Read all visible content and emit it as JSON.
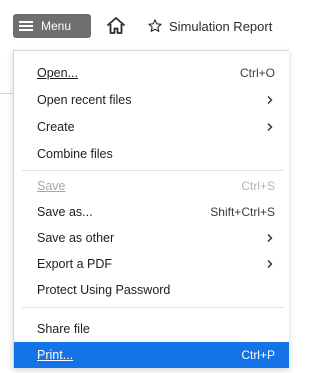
{
  "toolbar": {
    "menu_label": "Menu",
    "tab_title": "Simulation Report"
  },
  "menu": {
    "items": [
      {
        "label": "Open...",
        "shortcut": "Ctrl+O"
      },
      {
        "label": "Open recent files",
        "submenu": true
      },
      {
        "label": "Create",
        "submenu": true
      },
      {
        "label": "Combine files"
      },
      {
        "label": "Save",
        "shortcut": "Ctrl+S",
        "disabled": true
      },
      {
        "label": "Save as...",
        "shortcut": "Shift+Ctrl+S"
      },
      {
        "label": "Save as other",
        "submenu": true
      },
      {
        "label": "Export a PDF",
        "submenu": true
      },
      {
        "label": "Protect Using Password"
      },
      {
        "label": "Share file"
      },
      {
        "label": "Print...",
        "shortcut": "Ctrl+P",
        "selected": true
      }
    ]
  },
  "colors": {
    "menu_button_bg": "#6f6f6f",
    "selected_bg": "#1473e6",
    "disabled_text": "#a8a8a8"
  },
  "icons": {
    "menu": "hamburger-icon",
    "home": "home-icon",
    "tab": "star-icon",
    "submenu": "chevron-right-icon"
  }
}
